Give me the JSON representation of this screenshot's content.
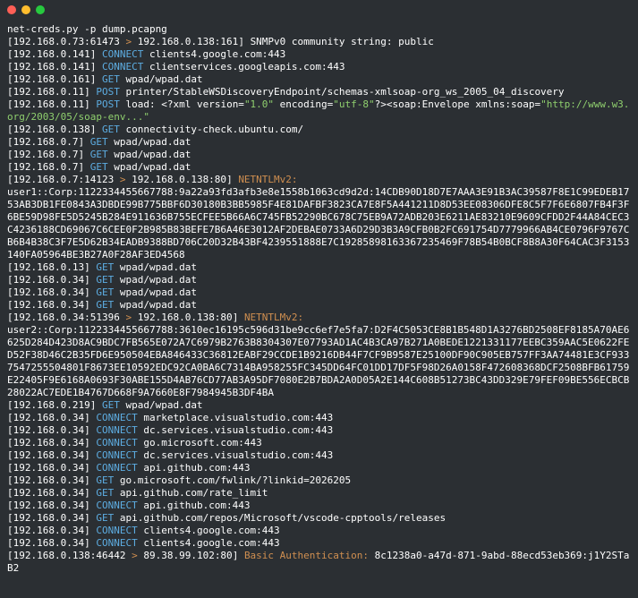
{
  "command": "net-creds.py -p dump.pcapng",
  "lines": [
    {
      "type": "snmp",
      "src": "192.168.0.73:61473",
      "dst": "192.168.0.138:161",
      "text": "SNMPv0 community string: public"
    },
    {
      "type": "verb",
      "ip": "192.168.0.141",
      "verb": "CONNECT",
      "target": "clients4.google.com:443"
    },
    {
      "type": "verb",
      "ip": "192.168.0.141",
      "verb": "CONNECT",
      "target": "clientservices.googleapis.com:443"
    },
    {
      "type": "verb",
      "ip": "192.168.0.161",
      "verb": "GET",
      "target": "wpad/wpad.dat"
    },
    {
      "type": "verb",
      "ip": "192.168.0.11",
      "verb": "POST",
      "target": "printer/StableWSDiscoveryEndpoint/schemas-xmlsoap-org_ws_2005_04_discovery"
    },
    {
      "type": "postload",
      "ip": "192.168.0.11",
      "prefix": "POST load: <?xml version=",
      "q1": "\"1.0\"",
      "mid": " encoding=",
      "q2": "\"utf-8\"",
      "suffix": "?><soap:Envelope xmlns:soap=",
      "q3": "\"http://www.w3.org/2003/05/soap-env...\""
    },
    {
      "type": "verb",
      "ip": "192.168.0.138",
      "verb": "GET",
      "target": "connectivity-check.ubuntu.com/"
    },
    {
      "type": "verb",
      "ip": "192.168.0.7",
      "verb": "GET",
      "target": "wpad/wpad.dat"
    },
    {
      "type": "verb",
      "ip": "192.168.0.7",
      "verb": "GET",
      "target": "wpad/wpad.dat"
    },
    {
      "type": "verb",
      "ip": "192.168.0.7",
      "verb": "GET",
      "target": "wpad/wpad.dat"
    },
    {
      "type": "ntlm",
      "src": "192.168.0.7:14123",
      "dst": "192.168.0.138:80",
      "label": "NETNTLMv2:",
      "hash": "user1::Corp:1122334455667788:9a22a93fd3afb3e8e1558b1063cd9d2d:14CDB90D18D7E7AAA3E91B3AC39587F8E1C99EDEB1753AB3DB1FE0843A3DBDE99B775BBF6D30180B3BB5985F4E81DAFBF3823CA7E8F5A441211D8D53EE08306DFE8C5F7F6E6807FB4F3F6BE59D98FE5D5245B284E911636B755ECFEE5B66A6C745FB52290BC678C75EB9A72ADB203E6211AE83210E9609CFDD2F44A84CEC3C4236188CD69067C6CEE0F2B985B83BEFE7B6A46E3012AF2DEBAE0733A6D29D3B3A9CFB0B2FC691754D7779966AB4CE0796F9767CB6B4B38C3F7E5D62B34EADB9388BD706C20D32B43BF4239551888E7C19285898163367235469F78B54B0BCF8B8A30F64CAC3F3153140FA05964BE3B27A0F28AF3ED4568"
    },
    {
      "type": "verb",
      "ip": "192.168.0.13",
      "verb": "GET",
      "target": "wpad/wpad.dat"
    },
    {
      "type": "verb",
      "ip": "192.168.0.34",
      "verb": "GET",
      "target": "wpad/wpad.dat"
    },
    {
      "type": "verb",
      "ip": "192.168.0.34",
      "verb": "GET",
      "target": "wpad/wpad.dat"
    },
    {
      "type": "verb",
      "ip": "192.168.0.34",
      "verb": "GET",
      "target": "wpad/wpad.dat"
    },
    {
      "type": "ntlm",
      "src": "192.168.0.34:51396",
      "dst": "192.168.0.138:80",
      "label": "NETNTLMv2:",
      "hash": "user2::Corp:1122334455667788:3610ec16195c596d31be9cc6ef7e5fa7:D2F4C5053CE8B1B548D1A3276BD2508EF8185A70AE6625D284D423D8AC9BDC7FB565E072A7C6979B2763B8304307E07793AD1AC4B3CA97B271A0BEDE1221331177EEBC359AAC5E0622FED52F38D46C2B35FD6E950504EBA846433C36812EABF29CCDE1B9216DB44F7CF9B9587E25100DF90C905EB757FF3AA74481E3CF9337547255504801F8673EE10592EDC92CA0BA6C7314BA958255FC345DD64FC01DD17DF5F98D26A0158F472608368DCF2508BFB61759E22405F9E6168A0693F30ABE155D4AB76CD77AB3A95DF7080E2B7BDA2A0D05A2E144C608B51273BC43DD329E79FEF09BE556ECBCB28022AC7EDE1B4767D668F9A7660E8F7984945B3DF4BA"
    },
    {
      "type": "verb",
      "ip": "192.168.0.219",
      "verb": "GET",
      "target": "wpad/wpad.dat"
    },
    {
      "type": "verb",
      "ip": "192.168.0.34",
      "verb": "CONNECT",
      "target": "marketplace.visualstudio.com:443"
    },
    {
      "type": "verb",
      "ip": "192.168.0.34",
      "verb": "CONNECT",
      "target": "dc.services.visualstudio.com:443"
    },
    {
      "type": "verb",
      "ip": "192.168.0.34",
      "verb": "CONNECT",
      "target": "go.microsoft.com:443"
    },
    {
      "type": "verb",
      "ip": "192.168.0.34",
      "verb": "CONNECT",
      "target": "dc.services.visualstudio.com:443"
    },
    {
      "type": "verb",
      "ip": "192.168.0.34",
      "verb": "CONNECT",
      "target": "api.github.com:443"
    },
    {
      "type": "verb",
      "ip": "192.168.0.34",
      "verb": "GET",
      "target": "go.microsoft.com/fwlink/?linkid=2026205"
    },
    {
      "type": "verb",
      "ip": "192.168.0.34",
      "verb": "GET",
      "target": "api.github.com/rate_limit"
    },
    {
      "type": "verb",
      "ip": "192.168.0.34",
      "verb": "CONNECT",
      "target": "api.github.com:443"
    },
    {
      "type": "verb",
      "ip": "192.168.0.34",
      "verb": "GET",
      "target": "api.github.com/repos/Microsoft/vscode-cpptools/releases"
    },
    {
      "type": "verb",
      "ip": "192.168.0.34",
      "verb": "CONNECT",
      "target": "clients4.google.com:443"
    },
    {
      "type": "verb",
      "ip": "192.168.0.34",
      "verb": "CONNECT",
      "target": "clients4.google.com:443"
    },
    {
      "type": "basic",
      "src": "192.168.0.138:46442",
      "dst": "89.38.99.102:80",
      "label": "Basic Authentication:",
      "cred": "8c1238a0-a47d-871-9abd-88ecd53eb369:j1Y2STaB2"
    }
  ]
}
